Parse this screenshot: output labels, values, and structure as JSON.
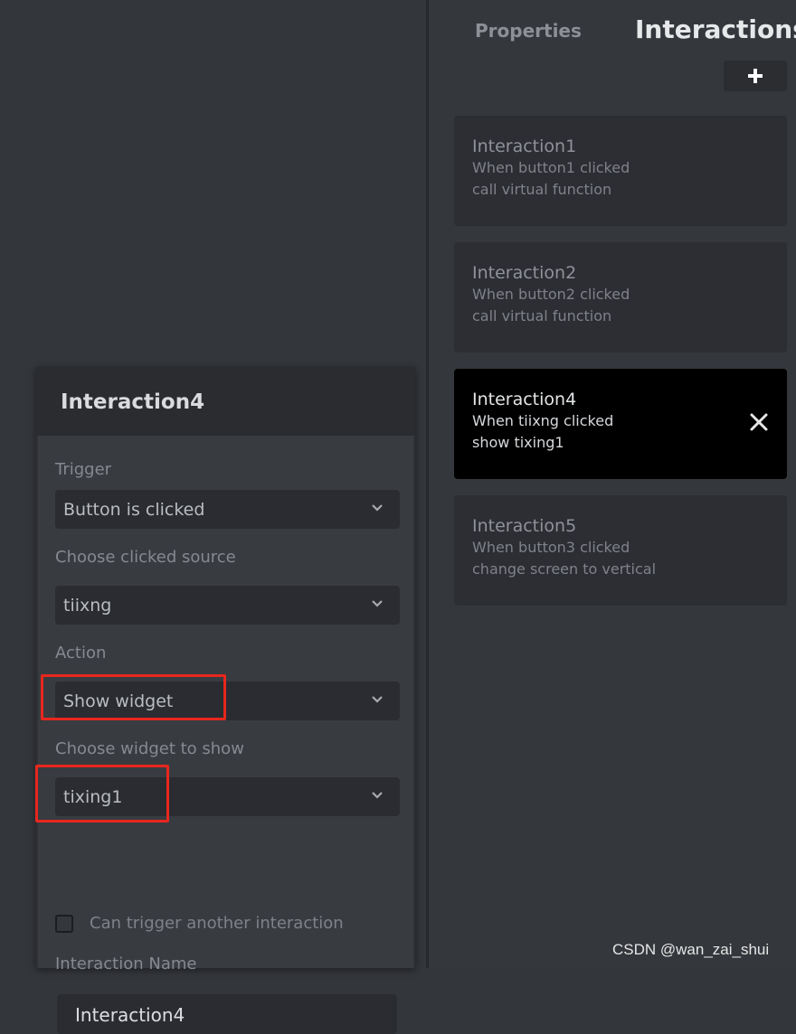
{
  "tabs": {
    "properties": "Properties",
    "interactions": "Interactions"
  },
  "add_button_icon": "plus-icon",
  "interactions": [
    {
      "title": "Interaction1",
      "line1": "When button1 clicked",
      "line2": "call virtual function",
      "active": false
    },
    {
      "title": "Interaction2",
      "line1": "When button2 clicked",
      "line2": "call virtual function",
      "active": false
    },
    {
      "title": "Interaction4",
      "line1": "When tiixng clicked",
      "line2": "show tixing1",
      "active": true
    },
    {
      "title": "Interaction5",
      "line1": "When button3 clicked",
      "line2": "change screen to vertical",
      "active": false
    }
  ],
  "editor": {
    "title": "Interaction4",
    "trigger_label": "Trigger",
    "trigger_value": "Button is clicked",
    "source_label": "Choose clicked source",
    "source_value": "tiixng",
    "action_label": "Action",
    "action_value": "Show widget",
    "widget_label": "Choose widget to show",
    "widget_value": "tixing1",
    "can_trigger_label": "Can trigger another interaction",
    "can_trigger_checked": false,
    "name_label": "Interaction Name",
    "name_value": "Interaction4"
  },
  "colors": {
    "accent_highlight": "#e8271d",
    "active_card": "#000000"
  },
  "watermark": "CSDN @wan_zai_shui"
}
